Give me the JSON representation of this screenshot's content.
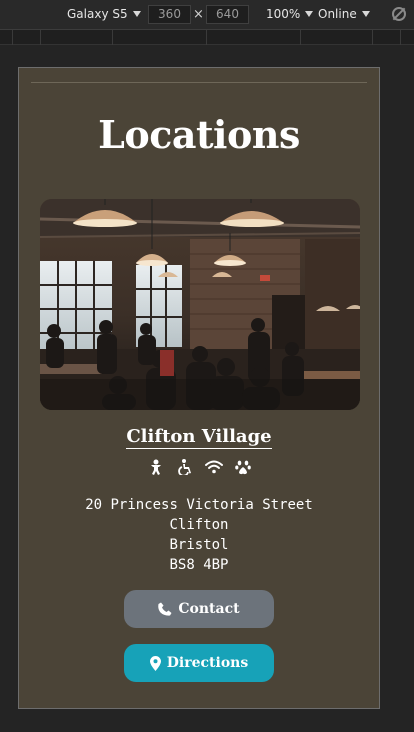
{
  "devtools": {
    "device": "Galaxy S5",
    "width": "360",
    "height": "640",
    "times": "×",
    "zoom": "100%",
    "network": "Online"
  },
  "page": {
    "title": "Locations",
    "location": {
      "name": "Clifton Village",
      "amenities": [
        "baby-changing-icon",
        "wheelchair-icon",
        "wifi-icon",
        "paw-icon"
      ],
      "address": [
        "20 Princess Victoria Street",
        "Clifton",
        "Bristol",
        "BS8 4BP"
      ]
    },
    "buttons": {
      "contact": "Contact",
      "directions": "Directions"
    }
  },
  "colors": {
    "page_bg": "#4b4437",
    "contact_btn": "#6c737b",
    "directions_btn": "#17a2b8"
  }
}
